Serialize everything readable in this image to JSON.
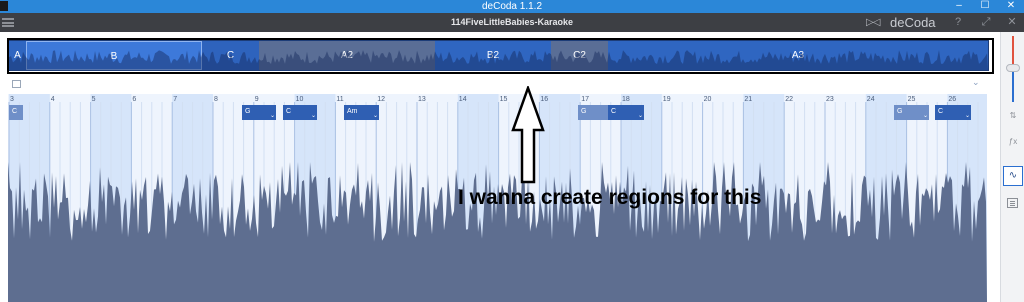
{
  "window": {
    "title": "deCoda 1.1.2"
  },
  "toolbar": {
    "document_title": "114FiveLittleBabies-Karaoke",
    "brand": "deCoda",
    "help": "?",
    "fullscreen": "⤢",
    "close": "✕"
  },
  "overview": {
    "sections": [
      {
        "label": "A",
        "color": "#2f66c1"
      },
      {
        "label": "B",
        "color": "#3d79da"
      },
      {
        "label": "C",
        "color": "#2e63bd"
      },
      {
        "label": "A2",
        "color": "#5a6e96"
      },
      {
        "label": "B2",
        "color": "#2f66c1"
      },
      {
        "label": "C2",
        "color": "#5a6e96"
      },
      {
        "label": "A3",
        "color": "#2f66c1"
      }
    ]
  },
  "timeline": {
    "bars": [
      "3",
      "4",
      "5",
      "6",
      "7",
      "8",
      "9",
      "10",
      "11",
      "12",
      "13",
      "14",
      "15",
      "16",
      "17",
      "18",
      "19",
      "20",
      "21",
      "22",
      "23",
      "24",
      "25",
      "26"
    ],
    "chords": [
      "C",
      "G",
      "C",
      "Am",
      "G",
      "C",
      "G",
      "C"
    ]
  },
  "annotation": {
    "text": "I wanna create regions for this"
  },
  "colors": {
    "titlebar": "#2b87d8",
    "toolbar": "#3d3f44",
    "accent": "#2f66c1",
    "waveform": "#5e6e90"
  }
}
